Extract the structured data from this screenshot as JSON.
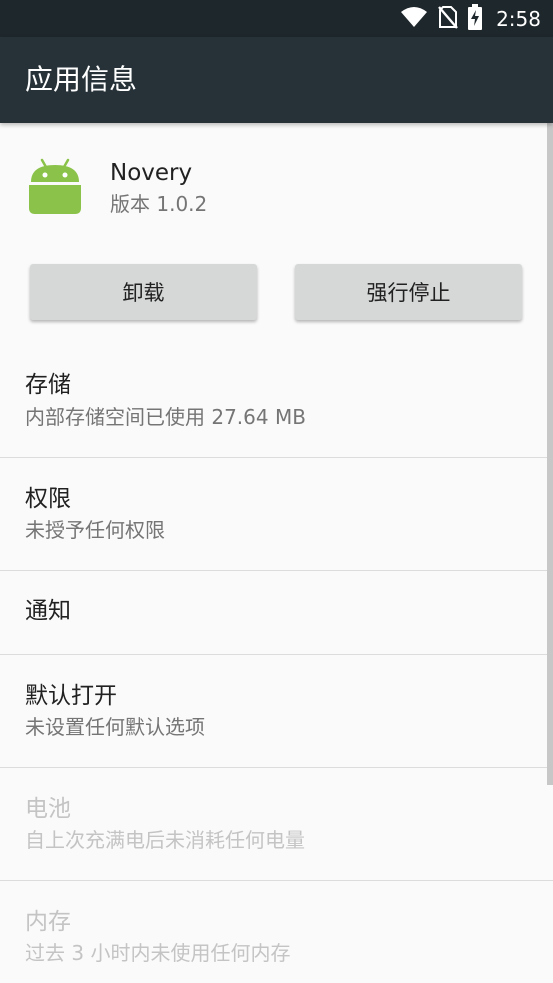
{
  "status_bar": {
    "time": "2:58",
    "icons": [
      "wifi-icon",
      "no-sim-icon",
      "battery-charging-icon"
    ]
  },
  "app_bar": {
    "title": "应用信息"
  },
  "app": {
    "name": "Novery",
    "version": "版本 1.0.2",
    "icon": "android-icon",
    "icon_color": "#8bc34a"
  },
  "buttons": {
    "uninstall": "卸载",
    "force_stop": "强行停止"
  },
  "rows": [
    {
      "title": "存储",
      "subtitle": "内部存储空间已使用 27.64 MB",
      "enabled": true
    },
    {
      "title": "权限",
      "subtitle": "未授予任何权限",
      "enabled": true
    },
    {
      "title": "通知",
      "subtitle": "",
      "enabled": true
    },
    {
      "title": "默认打开",
      "subtitle": "未设置任何默认选项",
      "enabled": true
    },
    {
      "title": "电池",
      "subtitle": "自上次充满电后未消耗任何电量",
      "enabled": false
    },
    {
      "title": "内存",
      "subtitle": "过去 3 小时内未使用任何内存",
      "enabled": false
    }
  ],
  "colors": {
    "status_bar": "#1e272c",
    "app_bar": "#263238",
    "background": "#fafafa",
    "button": "#d6d7d7"
  }
}
